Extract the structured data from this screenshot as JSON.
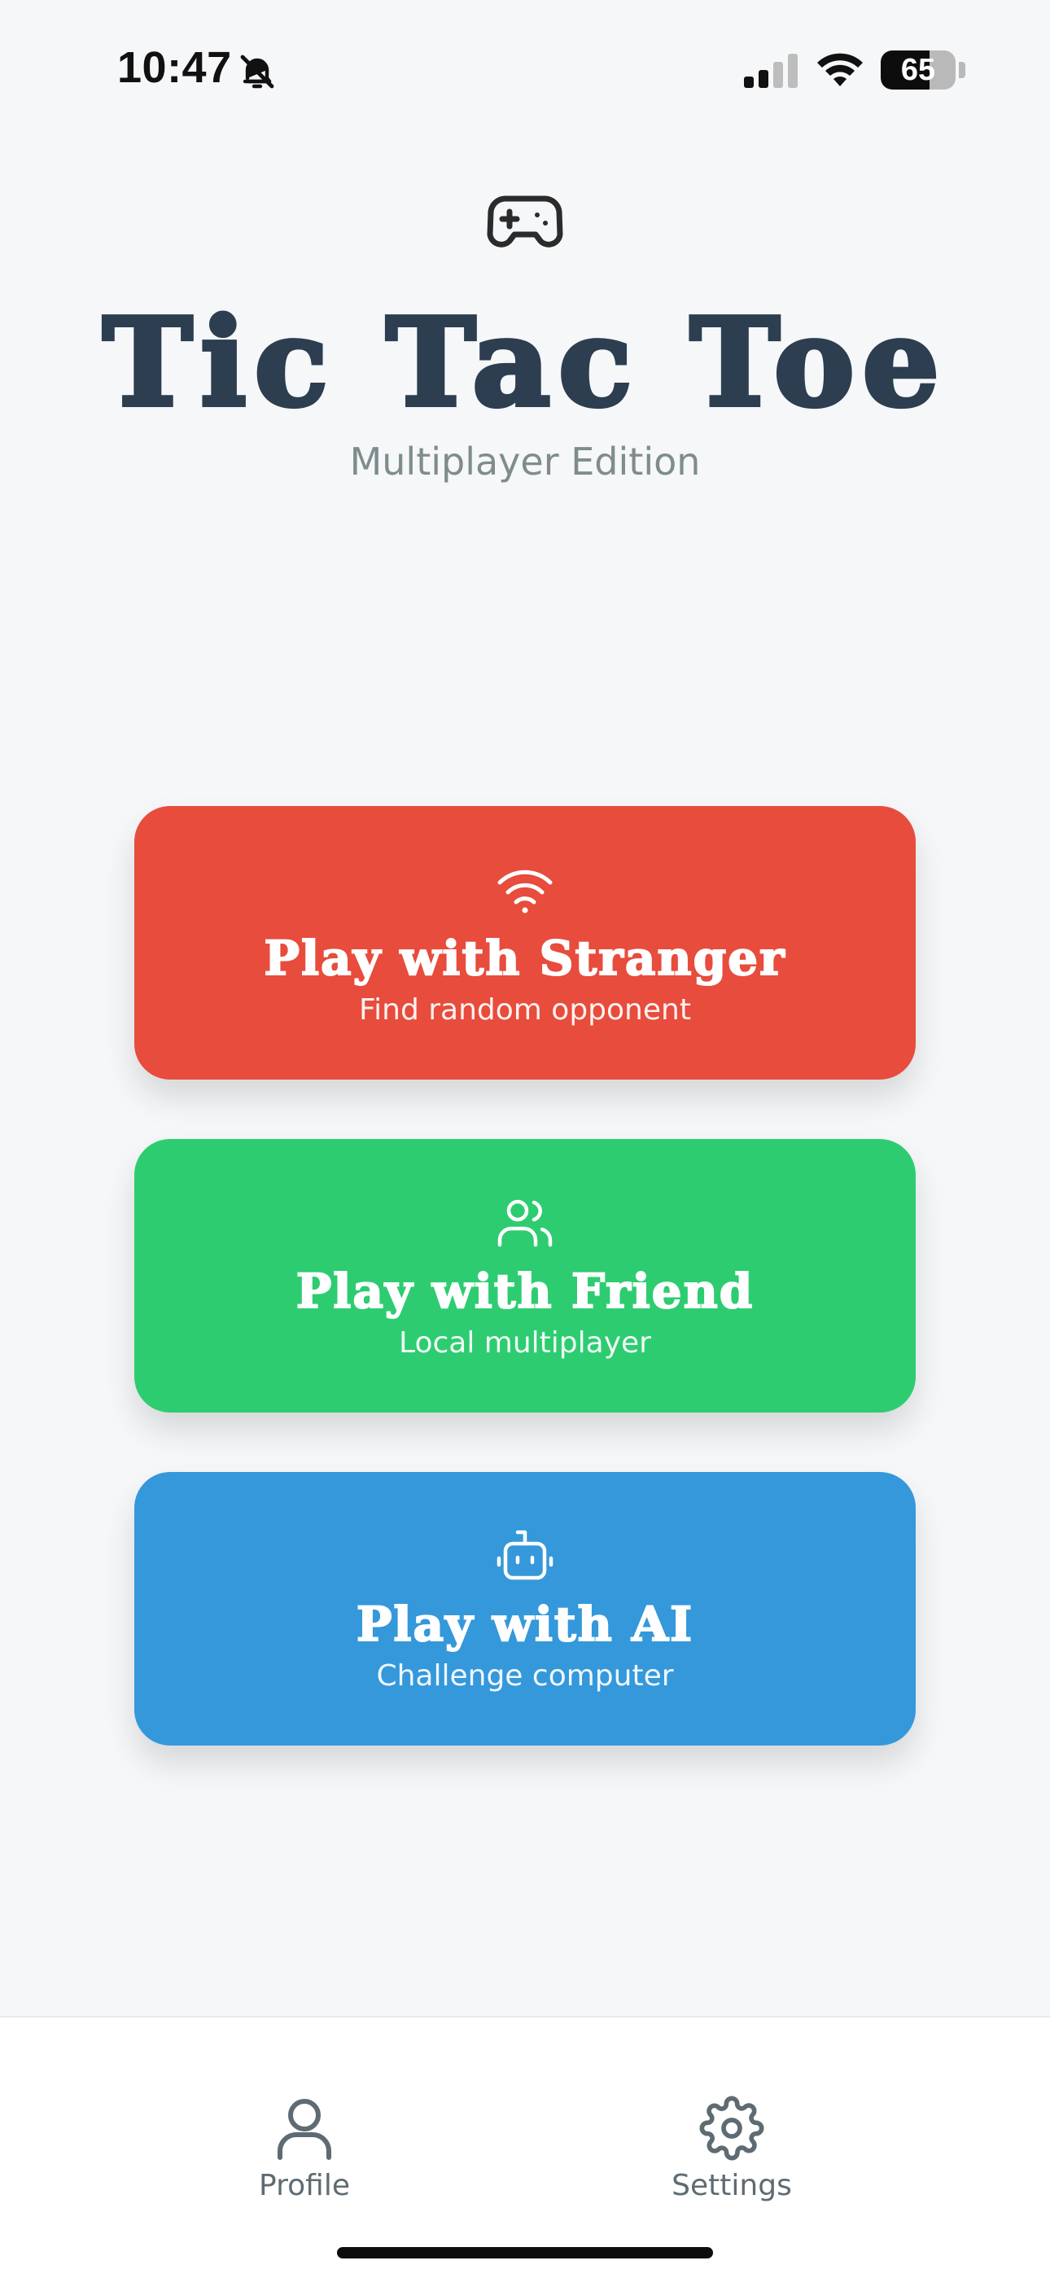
{
  "status_bar": {
    "time": "10:47",
    "battery_level": "65",
    "battery_fraction": 0.65,
    "icons": [
      "bell-slash-icon",
      "cellular-signal-icon",
      "wifi-icon",
      "battery-icon"
    ]
  },
  "header": {
    "icon": "gamepad-icon",
    "title": "Tic Tac Toe",
    "subtitle": "Multiplayer Edition"
  },
  "modes": [
    {
      "icon": "wifi-icon",
      "title": "Play with Stranger",
      "subtitle": "Find random opponent",
      "color": "#e74c3c"
    },
    {
      "icon": "users-icon",
      "title": "Play with Friend",
      "subtitle": "Local multiplayer",
      "color": "#2ecc71"
    },
    {
      "icon": "robot-icon",
      "title": "Play with AI",
      "subtitle": "Challenge computer",
      "color": "#3498db"
    }
  ],
  "bottom_nav": {
    "items": [
      {
        "icon": "user-icon",
        "label": "Profile"
      },
      {
        "icon": "gear-icon",
        "label": "Settings"
      }
    ]
  },
  "colors": {
    "background": "#f6f7f9",
    "title": "#2c3e50",
    "subtitle": "#7f8c8d",
    "nav_text": "#5f6b72"
  }
}
